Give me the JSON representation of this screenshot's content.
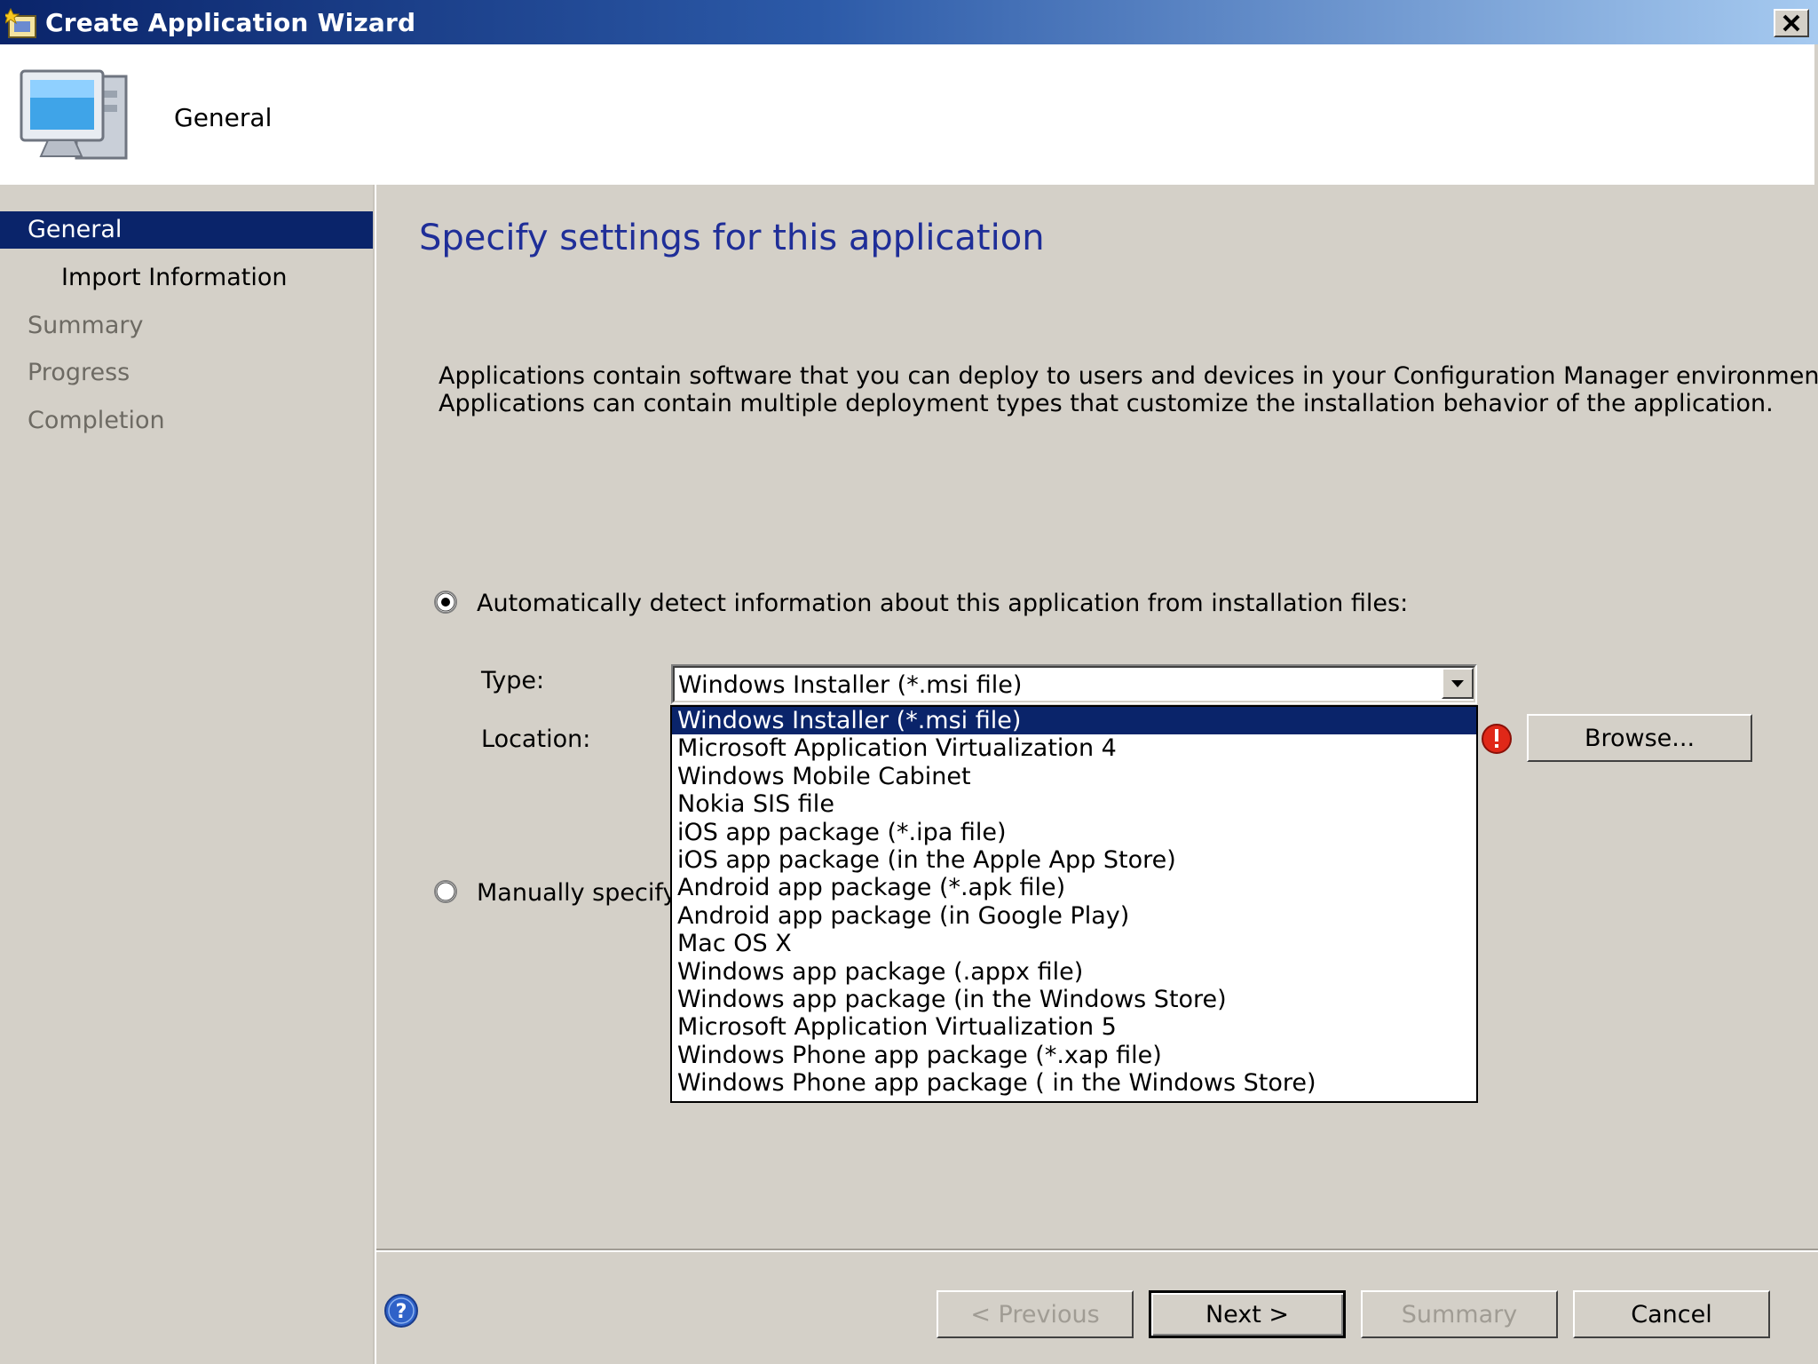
{
  "window": {
    "title": "Create Application Wizard"
  },
  "header": {
    "title": "General"
  },
  "nav": {
    "items": [
      {
        "label": "General",
        "state": "active"
      },
      {
        "label": "Import Information",
        "state": "current"
      },
      {
        "label": "Summary",
        "state": "inactive"
      },
      {
        "label": "Progress",
        "state": "inactive"
      },
      {
        "label": "Completion",
        "state": "inactive"
      }
    ]
  },
  "main": {
    "title": "Specify settings for this application",
    "description_line1": "Applications contain software that you can deploy to users and devices in your Configuration Manager environment.",
    "description_line2": "Applications can contain multiple deployment types that customize the installation behavior of the application.",
    "auto_detect": {
      "label": "Automatically detect information about this application from installation files:",
      "checked": true
    },
    "type": {
      "label": "Type:",
      "value": "Windows Installer (*.msi file)",
      "options": [
        "Windows Installer (*.msi file)",
        "Microsoft Application Virtualization 4",
        "Windows Mobile Cabinet",
        "Nokia SIS file",
        "iOS app package (*.ipa file)",
        "iOS app package (in the Apple App Store)",
        "Android app package (*.apk file)",
        "Android app package (in Google Play)",
        "Mac OS X",
        "Windows app package (.appx file)",
        "Windows app package (in the Windows Store)",
        "Microsoft Application Virtualization 5",
        "Windows Phone app package (*.xap file)",
        "Windows Phone app package ( in the Windows Store)"
      ]
    },
    "location": {
      "label": "Location:",
      "browse_label": "Browse..."
    },
    "manual": {
      "label": "Manually specify t",
      "checked": false
    }
  },
  "footer": {
    "previous_label": "< Previous",
    "next_label": "Next >",
    "summary_label": "Summary",
    "cancel_label": "Cancel"
  },
  "colors": {
    "title_text": "#1f2e98",
    "selection": "#0a246a",
    "dialog_bg": "#d4d0c8"
  }
}
